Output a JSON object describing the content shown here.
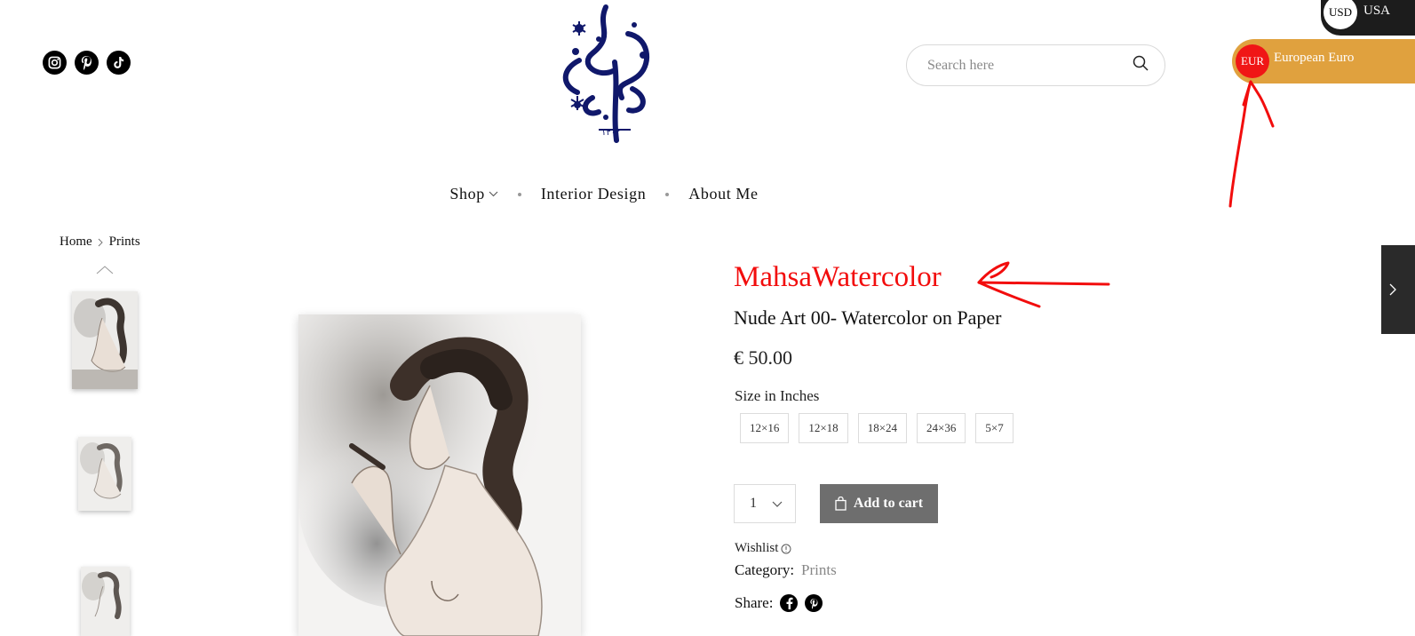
{
  "header": {
    "social_icons": [
      "instagram-icon",
      "pinterest-icon",
      "tiktok-icon"
    ],
    "search": {
      "placeholder": "Search here",
      "icon": "search-icon"
    },
    "currency": {
      "active": {
        "code": "USD",
        "label": "USA"
      },
      "option": {
        "code": "EUR",
        "label": "European Euro"
      }
    },
    "logo_icon": "calligraphy-logo-icon"
  },
  "nav": {
    "items": [
      {
        "label": "Shop",
        "has_dropdown": true
      },
      {
        "label": "Interior Design"
      },
      {
        "label": "About Me"
      }
    ]
  },
  "breadcrumb": {
    "home": "Home",
    "current": "Prints"
  },
  "product": {
    "brand": "MahsaWatercolor",
    "title": "Nude Art 00- Watercolor on Paper",
    "price": "€ 50.00",
    "size_label": "Size in Inches",
    "sizes": [
      "12×16",
      "12×18",
      "18×24",
      "24×36",
      "5×7"
    ],
    "quantity": "1",
    "add_to_cart": "Add to cart",
    "wishlist": "Wishlist",
    "category_label": "Category:",
    "category_value": "Prints",
    "share_label": "Share:",
    "share_icons": [
      "facebook-icon",
      "pinterest-icon"
    ]
  },
  "colors": {
    "brand_red": "#f20d0d",
    "currency_gold": "#e0a13e",
    "logo_navy": "#10186b",
    "cart_button": "#6e6e6e"
  }
}
